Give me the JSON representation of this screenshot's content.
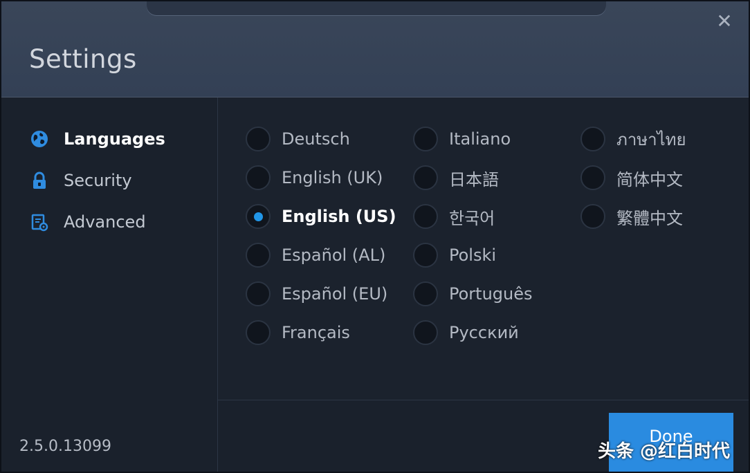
{
  "window": {
    "title": "Settings",
    "close_icon": "close-icon"
  },
  "sidebar": {
    "items": [
      {
        "label": "Languages",
        "icon": "globe-icon",
        "active": true
      },
      {
        "label": "Security",
        "icon": "lock-icon",
        "active": false
      },
      {
        "label": "Advanced",
        "icon": "advanced-settings-icon",
        "active": false
      }
    ],
    "version": "2.5.0.13099"
  },
  "languages": {
    "selected": "English (US)",
    "columns": [
      [
        "Deutsch",
        "English (UK)",
        "English (US)",
        "Español (AL)",
        "Español (EU)",
        "Français"
      ],
      [
        "Italiano",
        "日本語",
        "한국어",
        "Polski",
        "Português",
        "Русский"
      ],
      [
        "ภาษาไทย",
        "简体中文",
        "繁體中文"
      ]
    ]
  },
  "footer": {
    "done_label": "Done"
  },
  "overlay": {
    "watermark": "头条 @红白时代"
  },
  "colors": {
    "accent": "#2a8be0",
    "radio_selected": "#2196e8",
    "header_bg": "#3a4659",
    "body_bg": "#1b222d"
  }
}
